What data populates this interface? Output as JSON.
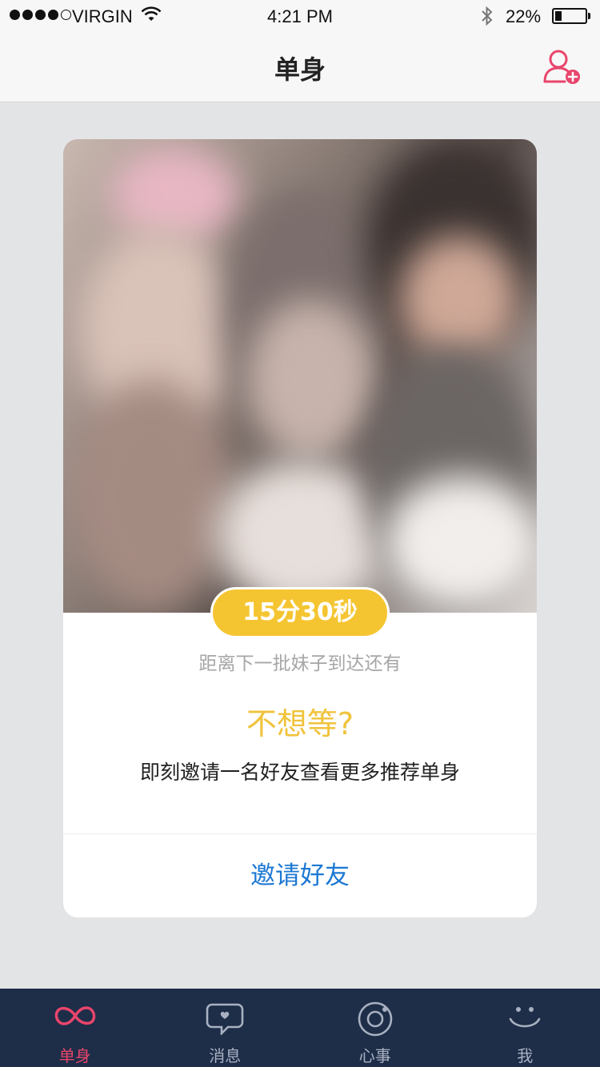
{
  "status_bar": {
    "carrier": "VIRGIN",
    "time": "4:21 PM",
    "battery_percent": "22%",
    "battery_level": 0.22,
    "signal_bars_filled": 4,
    "signal_bars_total": 5
  },
  "nav": {
    "title": "单身",
    "add_user_icon": "add-user-icon"
  },
  "card": {
    "image": "blurred-photo",
    "countdown": "15分30秒",
    "countdown_caption": "距离下一批妹子到达还有",
    "cta_title": "不想等?",
    "cta_subtitle": "即刻邀请一名好友查看更多推荐单身",
    "invite_button": "邀请好友"
  },
  "tabs": [
    {
      "label": "单身",
      "icon": "infinity-icon",
      "active": true
    },
    {
      "label": "消息",
      "icon": "chat-bubble-icon",
      "active": false
    },
    {
      "label": "心事",
      "icon": "camera-lens-icon",
      "active": false
    },
    {
      "label": "我",
      "icon": "smiley-icon",
      "active": false
    }
  ],
  "colors": {
    "accent_pink": "#e9456b",
    "badge_yellow": "#f5c531",
    "cta_yellow": "#f0c33b",
    "link_blue": "#1c78d3",
    "tabbar_bg": "#1e2d48"
  }
}
